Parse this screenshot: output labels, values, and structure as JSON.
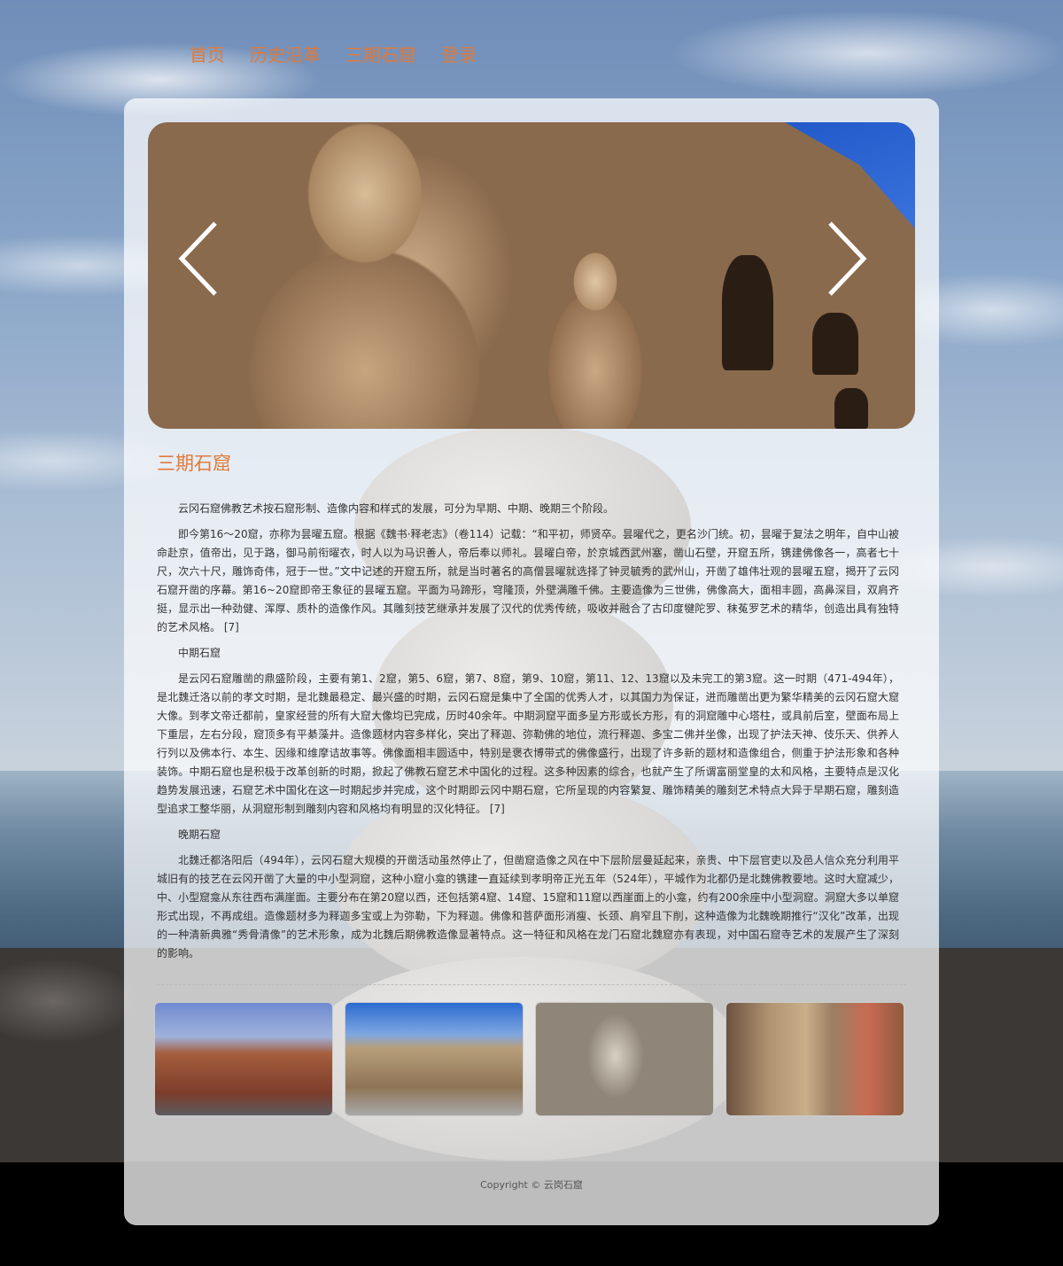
{
  "nav": {
    "items": [
      "首页",
      "历史沿革",
      "三期石窟",
      "登录"
    ]
  },
  "banner": {
    "prev_icon": "chevron-left-icon",
    "next_icon": "chevron-right-icon"
  },
  "section": {
    "title": "三期石窟"
  },
  "article": {
    "intro": "云冈石窟佛教艺术按石窟形制、造像内容和样式的发展，可分为早期、中期、晚期三个阶段。",
    "early": "即今第16～20窟，亦称为昙曜五窟。根据《魏书·释老志》（卷114）记载：“和平初，师贤卒。昙曜代之，更名沙门统。初，昙曜于复法之明年，自中山被命赴京，值帝出，见于路，御马前衔曜衣，时人以为马识善人，帝后奉以师礼。昙曜白帝，於京城西武州塞，凿山石壁，开窟五所，镌建佛像各一，高者七十尺，次六十尺，雕饰奇伟，冠于一世。”文中记述的开窟五所，就是当时著名的高僧昙曜就选择了钟灵毓秀的武州山，开凿了雄伟壮观的昙曜五窟，揭开了云冈石窟开凿的序幕。第16~20窟即帝王象征的昙曜五窟。平面为马蹄形，穹隆顶，外壁满雕千佛。主要造像为三世佛，佛像高大，面相丰圆，高鼻深目，双肩齐挺，显示出一种劲健、浑厚、质朴的造像作风。其雕刻技艺继承并发展了汉代的优秀传统，吸收并融合了古印度犍陀罗、秣菟罗艺术的精华，创造出具有独特的艺术风格。 [7]",
    "middle_title": "中期石窟",
    "middle": "是云冈石窟雕凿的鼎盛阶段，主要有第1、2窟，第5、6窟，第7、8窟，第9、10窟，第11、12、13窟以及未完工的第3窟。这一时期（471-494年），是北魏迁洛以前的孝文时期，是北魏最稳定、最兴盛的时期，云冈石窟是集中了全国的优秀人才，以其国力为保证，进而雕凿出更为繁华精美的云冈石窟大窟大像。到孝文帝迁都前，皇家经营的所有大窟大像均已完成，历时40余年。中期洞窟平面多呈方形或长方形，有的洞窟雕中心塔柱，或具前后室，壁面布局上下重层，左右分段，窟顶多有平綦藻井。造像题材内容多样化，突出了释迦、弥勒佛的地位，流行释迦、多宝二佛并坐像，出现了护法天神、伎乐天、供养人行列以及佛本行、本生、因缘和维摩诘故事等。佛像面相丰圆适中，特别是褒衣博带式的佛像盛行，出现了许多新的题材和造像组合，侧重于护法形象和各种装饰。中期石窟也是积极于改革创新的时期，掀起了佛教石窟艺术中国化的过程。这多种因素的综合，也就产生了所谓富丽堂皇的太和风格，主要特点是汉化趋势发展迅速，石窟艺术中国化在这一时期起步并完成，这个时期即云冈中期石窟，它所呈现的内容繁复、雕饰精美的雕刻艺术特点大异于早期石窟，雕刻造型追求工整华丽，从洞窟形制到雕刻内容和风格均有明显的汉化特征。 [7]",
    "late_title": "晚期石窟",
    "late": "北魏迁都洛阳后（494年），云冈石窟大规模的开凿活动虽然停止了，但凿窟造像之风在中下层阶层曼延起来，亲贵、中下层官吏以及邑人信众充分利用平城旧有的技艺在云冈开凿了大量的中小型洞窟，这种小窟小龛的镌建一直延续到孝明帝正光五年（524年），平城作为北都仍是北魏佛教要地。这时大窟减少，中、小型窟龛从东往西布满崖面。主要分布在第20窟以西，还包括第4窟、14窟、15窟和11窟以西崖面上的小龛，约有200余座中小型洞窟。洞窟大多以单窟形式出现，不再成组。造像题材多为释迦多宝或上为弥勒，下为释迦。佛像和菩萨面形消瘦、长颈、肩窄且下削，这种造像为北魏晚期推行“汉化”改革，出现的一种清新典雅“秀骨清像”的艺术形象，成为北魏后期佛教造像显著特点。这一特征和风格在龙门石窟北魏窟亦有表现，对中国石窟寺艺术的发展产生了深刻的影响。"
  },
  "footer": {
    "copyright": "Copyright © 云岗石窟"
  }
}
